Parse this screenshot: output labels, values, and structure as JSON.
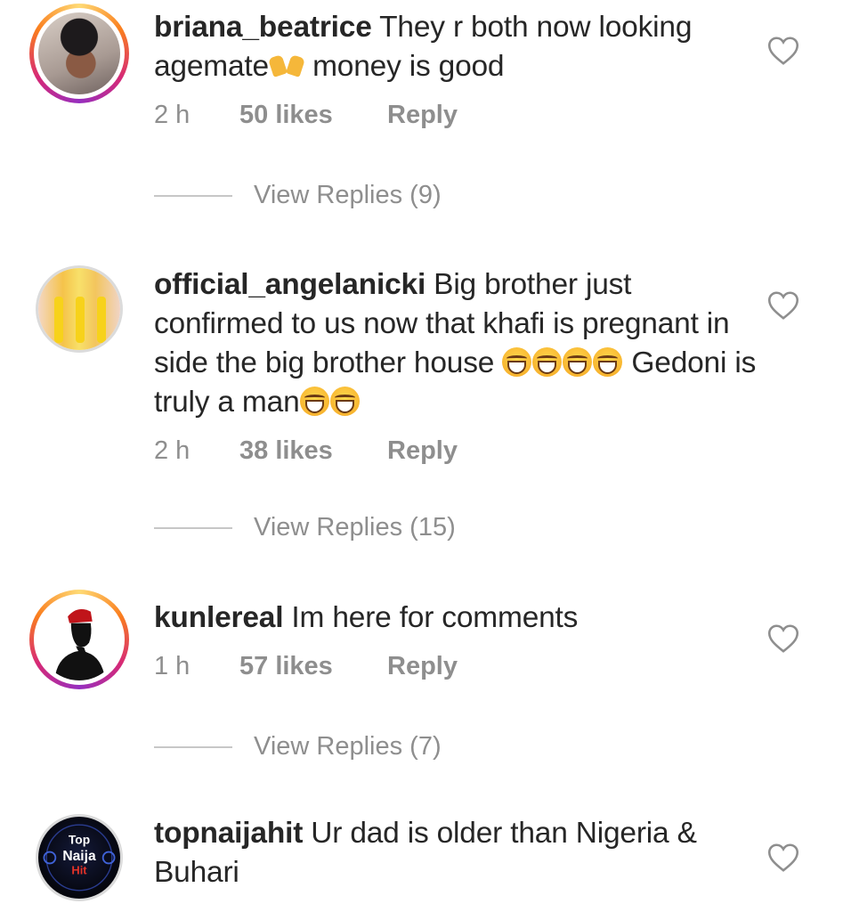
{
  "comments": [
    {
      "username": "briana_beatrice",
      "text_before": "They r both now looking agemate",
      "emoji_inline": "raising-hands",
      "text_after": " money is good",
      "time": "2 h",
      "likes": "50 likes",
      "reply": "Reply",
      "view_replies": "View Replies (9)",
      "has_story": true
    },
    {
      "username": "official_angelanicki",
      "text_before": "Big brother just confirmed to us now that khafi is pregnant in side the big brother house ",
      "text_after": " Gedoni is truly a man",
      "time": "2 h",
      "likes": "38 likes",
      "reply": "Reply",
      "view_replies": "View Replies (15)",
      "has_story": false
    },
    {
      "username": "kunlereal",
      "text": "Im here for comments",
      "time": "1 h",
      "likes": "57 likes",
      "reply": "Reply",
      "view_replies": "View Replies (7)",
      "has_story": true
    },
    {
      "username": "topnaijahit",
      "text": "Ur dad is older than Nigeria & Buhari",
      "avatar_logo": {
        "line1": "Top",
        "line2": "Naija",
        "line3": "Hit"
      },
      "has_story": false
    }
  ],
  "icons": {
    "like": "heart-outline-icon",
    "laugh": "face-with-tears-of-joy-emoji",
    "praise": "raising-hands-emoji"
  },
  "colors": {
    "text": "#262626",
    "muted": "#8e8e8e",
    "divider": "#c7c7c7"
  }
}
